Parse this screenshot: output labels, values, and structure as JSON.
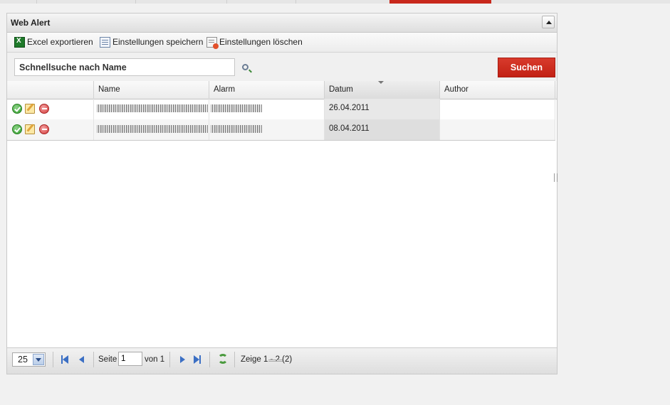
{
  "panel": {
    "title": "Web Alert"
  },
  "toolbar": {
    "export_label": "Excel exportieren",
    "save_label": "Einstellungen speichern",
    "delete_label": "Einstellungen löschen"
  },
  "search": {
    "placeholder": "Schnellsuche nach Name",
    "button_label": "Suchen"
  },
  "grid": {
    "columns": [
      "",
      "Name",
      "Alarm",
      "Datum",
      "Author"
    ],
    "sorted_column": "Datum",
    "rows": [
      {
        "name": "",
        "alarm": "",
        "datum": "26.04.2011",
        "author": ""
      },
      {
        "name": "",
        "alarm": "",
        "datum": "08.04.2011",
        "author": ""
      }
    ]
  },
  "pager": {
    "page_size": "25",
    "page_label": "Seite",
    "page_value": "1",
    "of_label": "von 1",
    "display_info": "Zeige 1 - 2 (2)"
  },
  "colors": {
    "accent": "#c8281c"
  }
}
